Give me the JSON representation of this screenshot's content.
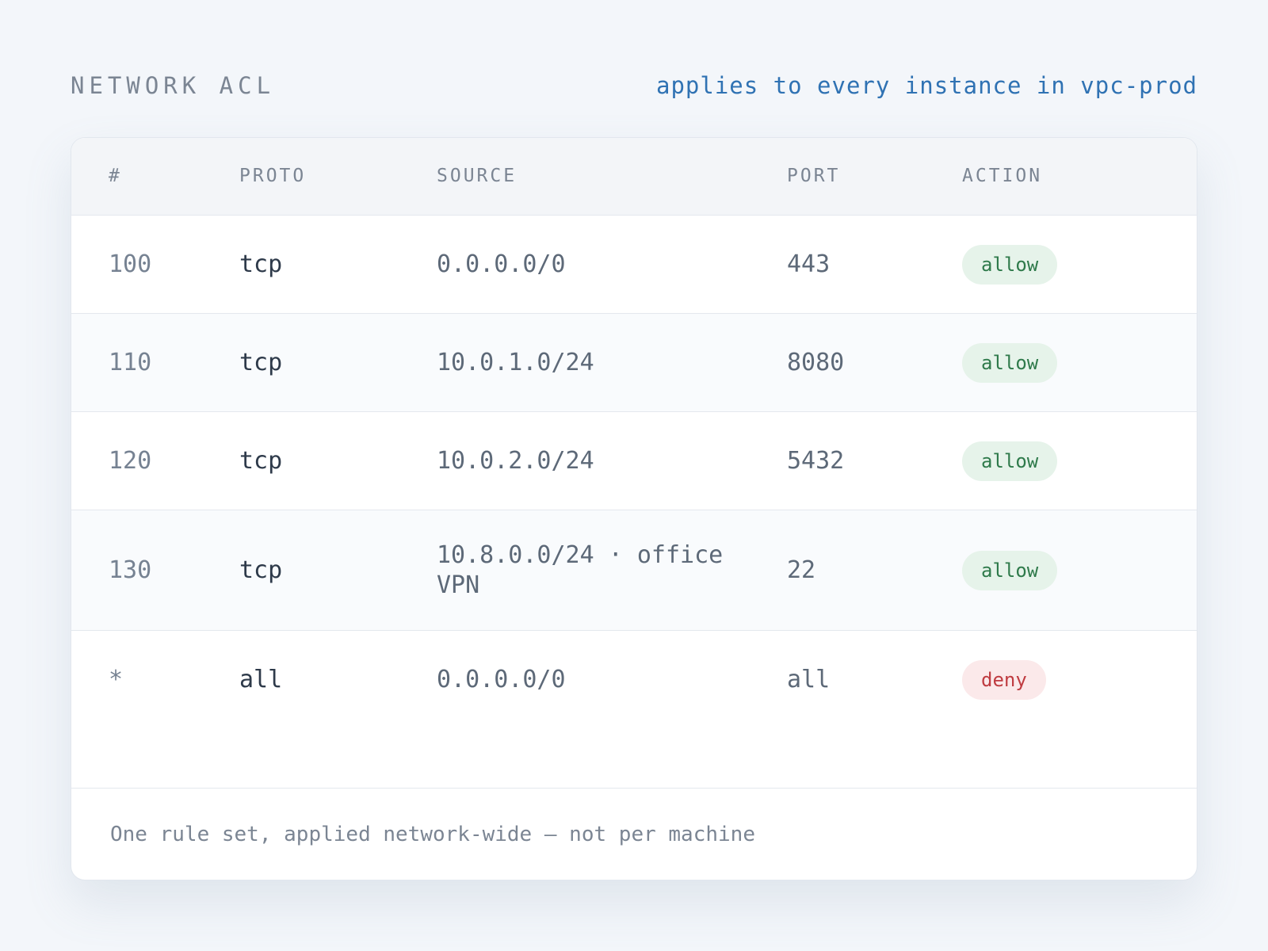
{
  "header": {
    "title": "NETWORK ACL",
    "scope": "applies to every instance in vpc-prod"
  },
  "table": {
    "columns": [
      "#",
      "PROTO",
      "SOURCE",
      "PORT",
      "ACTION"
    ],
    "rows": [
      {
        "num": "100",
        "proto": "tcp",
        "source": "0.0.0.0/0",
        "port": "443",
        "action": "allow"
      },
      {
        "num": "110",
        "proto": "tcp",
        "source": "10.0.1.0/24",
        "port": "8080",
        "action": "allow"
      },
      {
        "num": "120",
        "proto": "tcp",
        "source": "10.0.2.0/24",
        "port": "5432",
        "action": "allow"
      },
      {
        "num": "130",
        "proto": "tcp",
        "source": "10.8.0.0/24 · office VPN",
        "port": "22",
        "action": "allow"
      },
      {
        "num": "*",
        "proto": "all",
        "source": "0.0.0.0/0",
        "port": "all",
        "action": "deny"
      }
    ]
  },
  "footer": {
    "note": "One rule set, applied network-wide — not per machine"
  },
  "colors": {
    "allow_bg": "#e6f3ea",
    "allow_text": "#2f7a4b",
    "deny_bg": "#fbe9ea",
    "deny_text": "#bf3b40",
    "accent": "#2f72b3"
  }
}
